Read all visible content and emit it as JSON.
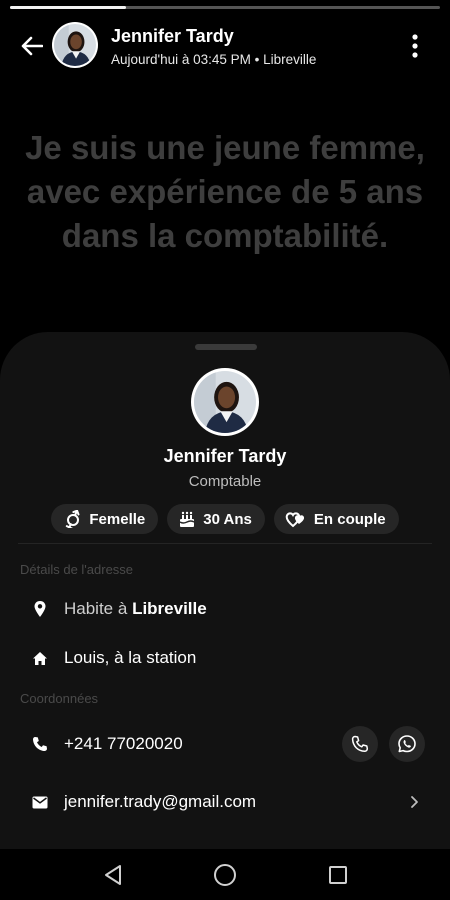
{
  "story": {
    "progress": 0.27
  },
  "header": {
    "name": "Jennifer Tardy",
    "subtitle": "Aujourd'hui à 03:45 PM • Libreville",
    "back_icon": "arrow-left-icon",
    "more_icon": "more-vertical-icon"
  },
  "status": {
    "text": "Je suis une jeune femme, avec expérience de 5 ans dans la comptabilité."
  },
  "profile": {
    "name": "Jennifer Tardy",
    "role": "Comptable",
    "chips": [
      {
        "icon": "gender-icon",
        "label": "Femelle"
      },
      {
        "icon": "birthday-cake-icon",
        "label": "30 Ans"
      },
      {
        "icon": "hearts-icon",
        "label": "En couple"
      }
    ]
  },
  "address": {
    "section_label": "Détails de l'adresse",
    "city_prefix": "Habite à",
    "city": "Libreville",
    "home": "Louis, à la station"
  },
  "contact": {
    "section_label": "Coordonnées",
    "phone": "+241 77020020",
    "email": "jennifer.trady@gmail.com"
  },
  "colors": {
    "background": "#000000",
    "sheet": "#121212",
    "chip": "#262626",
    "quote_text": "#3e3e3e",
    "section_label": "#4a4a4a"
  }
}
